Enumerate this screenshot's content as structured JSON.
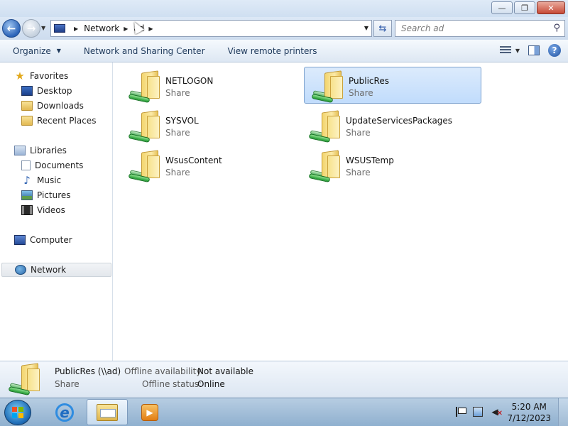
{
  "window": {
    "minimize_glyph": "—",
    "maximize_glyph": "❐",
    "close_glyph": "✕"
  },
  "nav": {
    "back_glyph": "←",
    "forward_glyph": "→",
    "breadcrumb": [
      "Network",
      "ad"
    ],
    "search_placeholder": "Search ad"
  },
  "toolbar": {
    "organize": "Organize",
    "network_sharing": "Network and Sharing Center",
    "remote_printers": "View remote printers",
    "help_glyph": "?"
  },
  "sidebar": {
    "favorites": {
      "label": "Favorites",
      "icon": "star-icon"
    },
    "favorites_items": [
      {
        "label": "Desktop",
        "icon": "desktop-icon"
      },
      {
        "label": "Downloads",
        "icon": "folder-icon"
      },
      {
        "label": "Recent Places",
        "icon": "folder-icon"
      }
    ],
    "libraries": {
      "label": "Libraries",
      "icon": "library-icon"
    },
    "library_items": [
      {
        "label": "Documents",
        "icon": "document-icon"
      },
      {
        "label": "Music",
        "icon": "music-note-icon"
      },
      {
        "label": "Pictures",
        "icon": "picture-icon"
      },
      {
        "label": "Videos",
        "icon": "film-icon"
      }
    ],
    "computer": {
      "label": "Computer",
      "icon": "computer-icon"
    },
    "network": {
      "label": "Network",
      "icon": "network-globe-icon",
      "selected": true
    }
  },
  "shares": [
    {
      "name": "NETLOGON",
      "type": "Share"
    },
    {
      "name": "PublicRes",
      "type": "Share",
      "selected": true
    },
    {
      "name": "SYSVOL",
      "type": "Share"
    },
    {
      "name": "UpdateServicesPackages",
      "type": "Share"
    },
    {
      "name": "WsusContent",
      "type": "Share"
    },
    {
      "name": "WSUSTemp",
      "type": "Share"
    }
  ],
  "details": {
    "name": "PublicRes (\\\\ad)",
    "type": "Share",
    "offline_availability_label": "Offline availability:",
    "offline_availability_value": "Not available",
    "offline_status_label": "Offline status:",
    "offline_status_value": "Online"
  },
  "taskbar": {
    "time": "5:20 AM",
    "date": "7/12/2023"
  },
  "colors": {
    "selection": "#c1dcfc",
    "chrome": "#dce8f6",
    "taskbar": "#8fb0cf"
  }
}
